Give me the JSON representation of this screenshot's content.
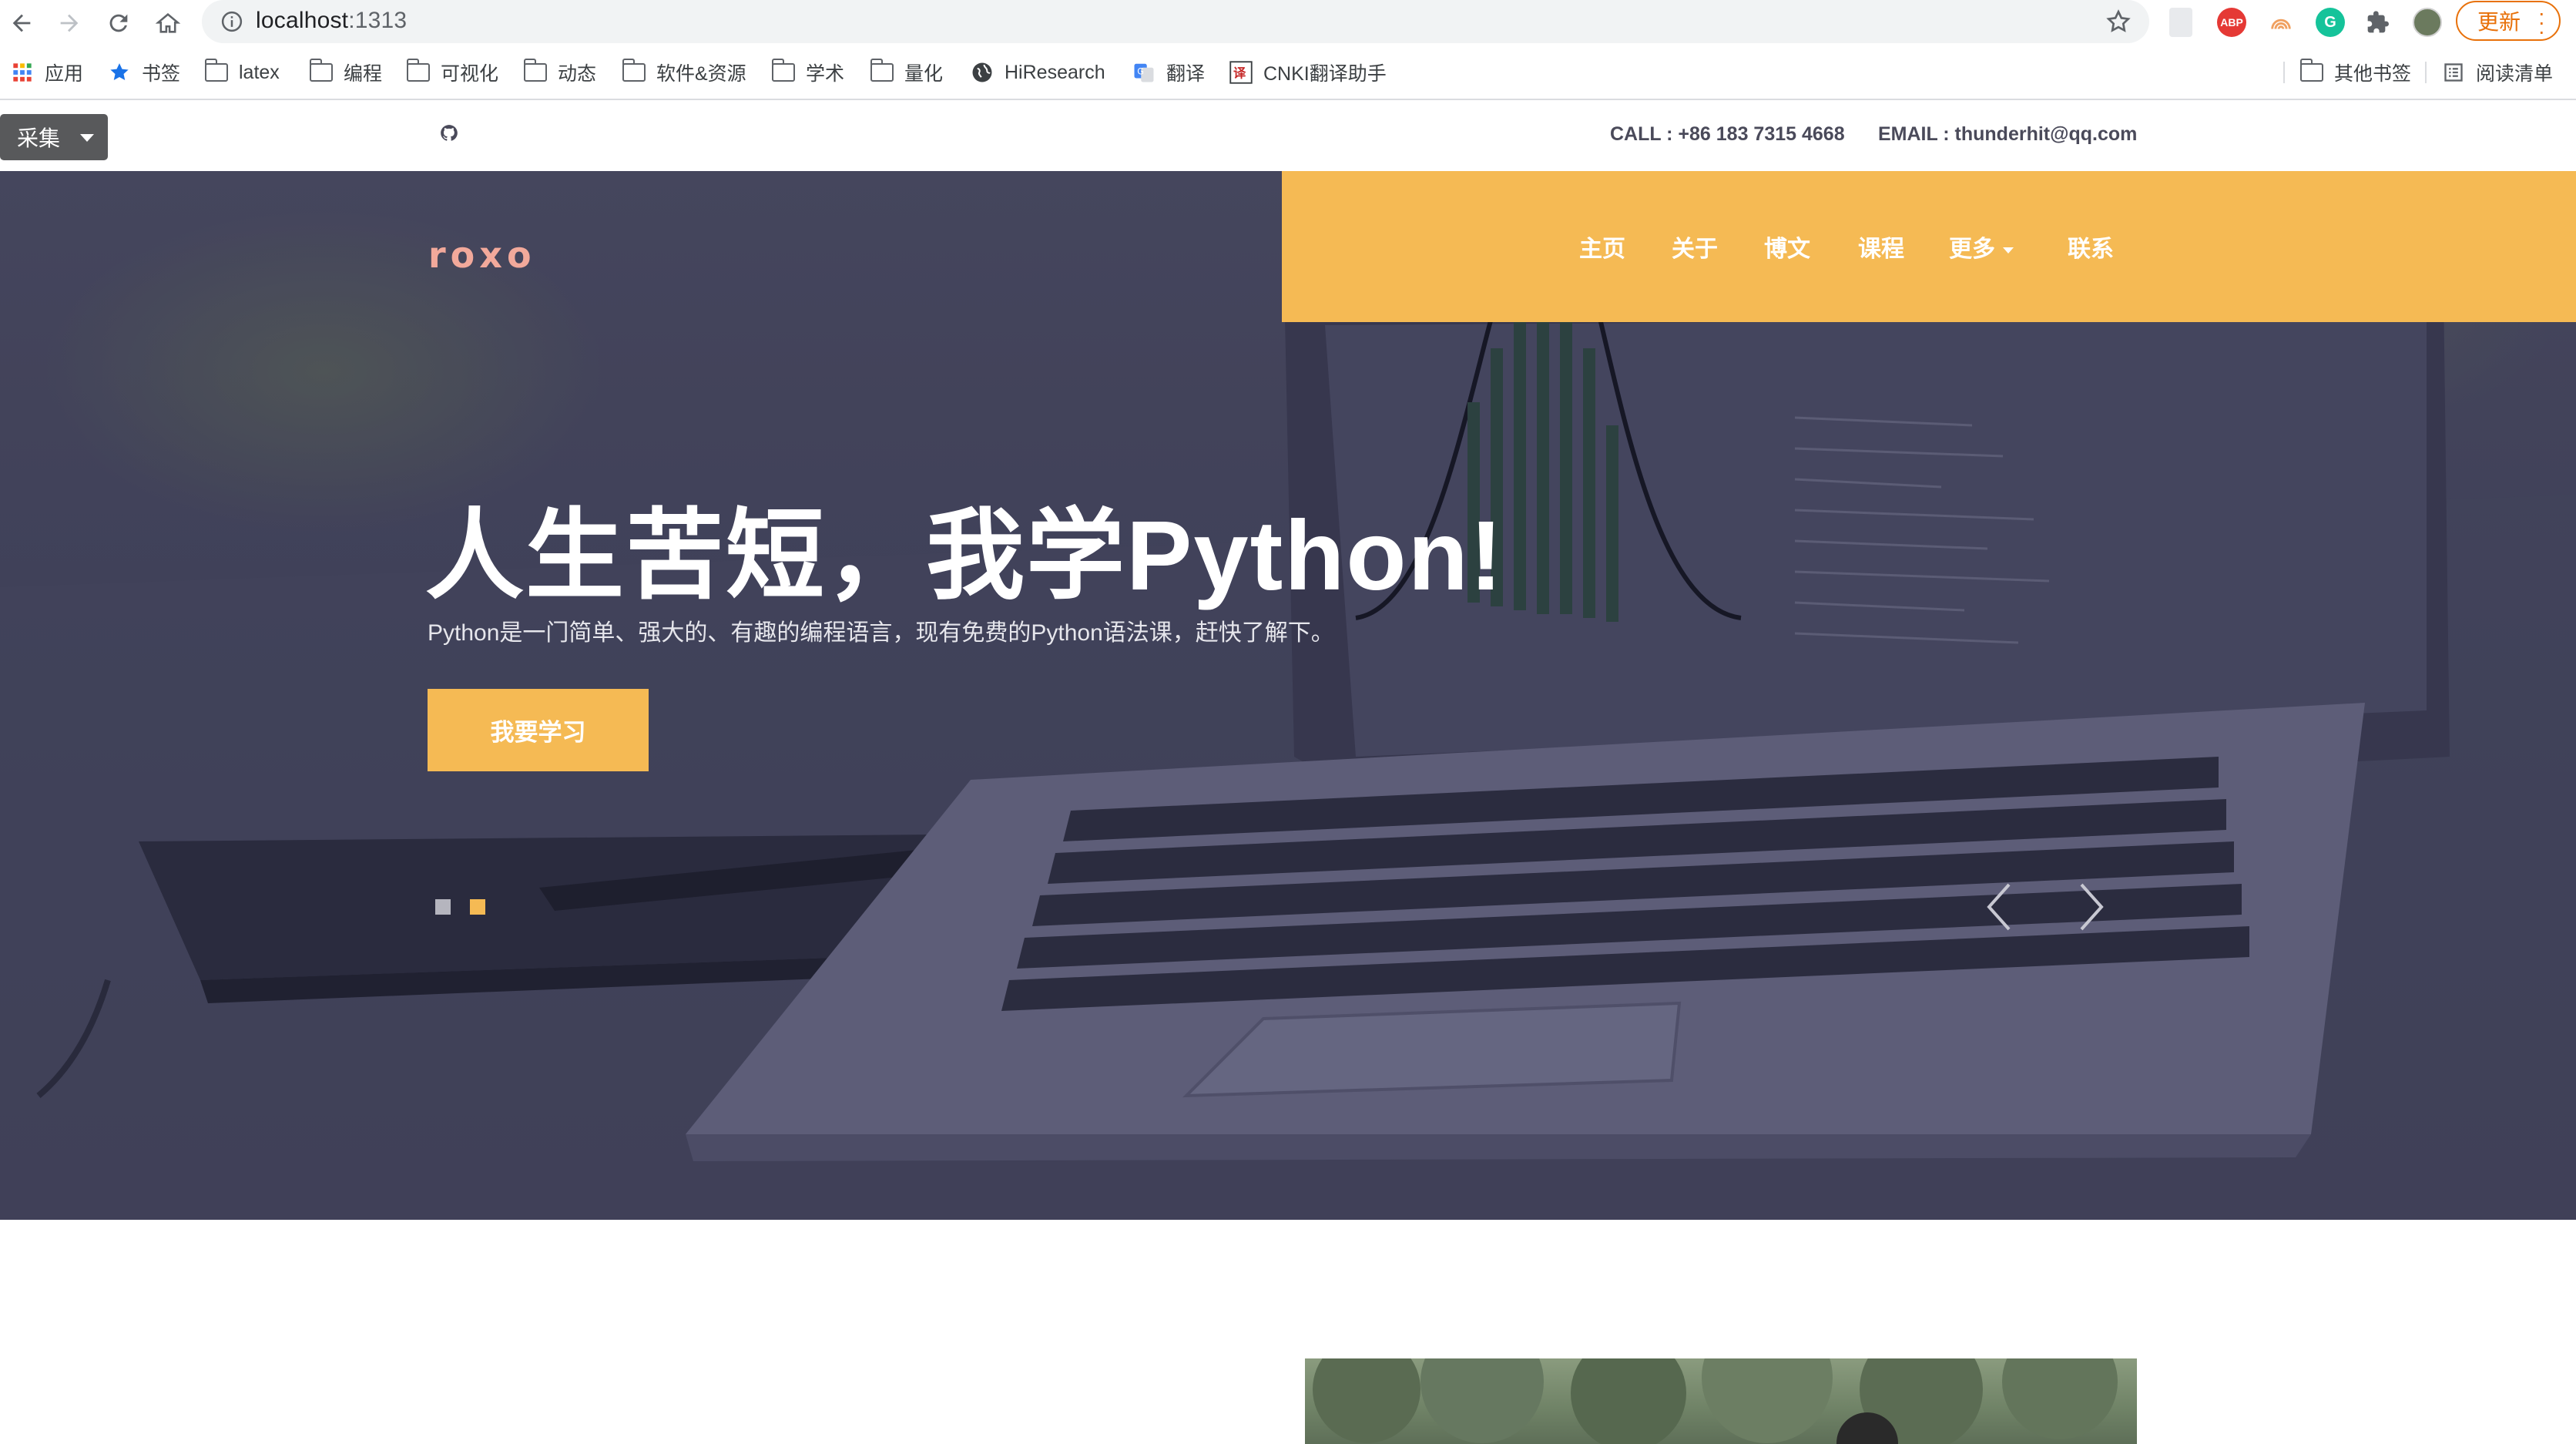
{
  "browser": {
    "url_host": "localhost",
    "url_port": ":1313",
    "update_label": "更新",
    "ext_abp_label": "ABP",
    "ext_grammarly_label": "G",
    "bookmarks": [
      {
        "label": "应用",
        "icon": "apps-grid-icon"
      },
      {
        "label": "书签",
        "icon": "star-icon"
      },
      {
        "label": "latex",
        "icon": "folder-icon"
      },
      {
        "label": "编程",
        "icon": "folder-icon"
      },
      {
        "label": "可视化",
        "icon": "folder-icon"
      },
      {
        "label": "动态",
        "icon": "folder-icon"
      },
      {
        "label": "软件&资源",
        "icon": "folder-icon"
      },
      {
        "label": "学术",
        "icon": "folder-icon"
      },
      {
        "label": "量化",
        "icon": "folder-icon"
      },
      {
        "label": "HiResearch",
        "icon": "globe-icon"
      },
      {
        "label": "翻译",
        "icon": "translate-icon"
      },
      {
        "label": "CNKI翻译助手",
        "icon": "cnki-icon"
      }
    ],
    "other_bookmarks": "其他书签",
    "reading_list": "阅读清单"
  },
  "topbar": {
    "collect_label": "采集",
    "call": "CALL : +86 183 7315 4668",
    "email": "EMAIL : thunderhit@qq.com"
  },
  "nav": {
    "logo": "roxo",
    "items": [
      "主页",
      "关于",
      "博文",
      "课程",
      "更多",
      "联系"
    ]
  },
  "hero": {
    "headline": "人生苦短，我学Python!",
    "subline": "Python是一门简单、强大的、有趣的编程语言，现有免费的Python语法课，赶快了解下。",
    "cta": "我要学习",
    "active_slide": 2,
    "slide_count": 2,
    "colors": {
      "accent": "#f5ba54",
      "dot_inactive": "#b5b5be"
    }
  }
}
